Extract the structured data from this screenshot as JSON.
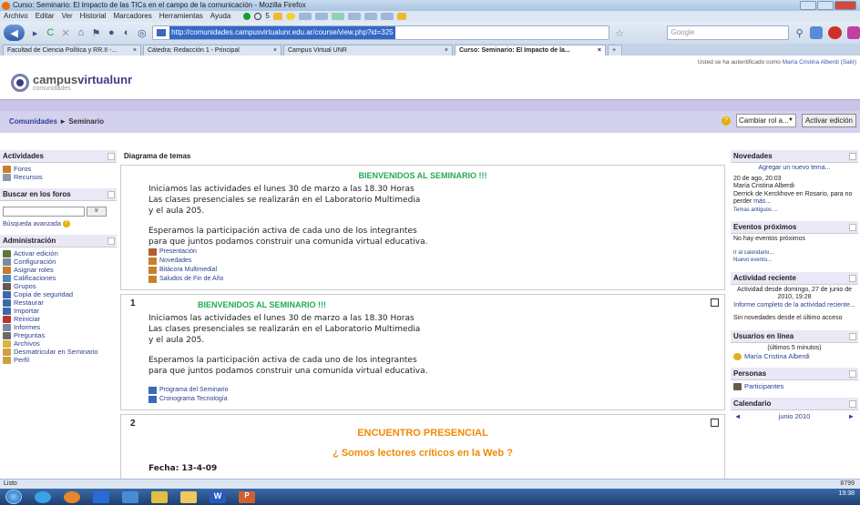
{
  "window": {
    "title": "Curso: Seminario: El Impacto de las TICs en el campo de la comunicación - Mozilla Firefox"
  },
  "menubar": [
    "Archivo",
    "Editar",
    "Ver",
    "Historial",
    "Marcadores",
    "Herramientas",
    "Ayuda"
  ],
  "toolbar_counter": "5",
  "navbar": {
    "url": "http://comunidades.campusvirtualunr.edu.ar/course/view.php?id=325",
    "search_placeholder": "Google"
  },
  "tabs": [
    {
      "label": "Facultad de Ciencia Política y RR.II -...",
      "active": false
    },
    {
      "label": "Cátedra: Redacción 1 - Principal",
      "active": false
    },
    {
      "label": "Campus Virtual UNR",
      "active": false
    },
    {
      "label": "Curso: Seminario: El Impacto de la...",
      "active": true
    }
  ],
  "site": {
    "logo_part1": "campus",
    "logo_part2": "virtualunr",
    "logo_sub": "comunidades",
    "login_prefix": "Usted se ha autentificado como",
    "login_user": "María Cristina Alberdi",
    "login_suffix": "(Salir)"
  },
  "breadcrumb": {
    "root": "Comunidades",
    "sep": "►",
    "current": "Seminario"
  },
  "role": {
    "label": "Cambiar rol a...",
    "button": "Activar edición"
  },
  "left": {
    "actividades": {
      "title": "Actividades",
      "items": [
        "Foros",
        "Recursos"
      ]
    },
    "buscar": {
      "title": "Buscar en los foros",
      "go": "Ir",
      "advanced": "Búsqueda avanzada"
    },
    "admin": {
      "title": "Administración",
      "items": [
        "Activar edición",
        "Configuración",
        "Asignar roles",
        "Calificaciones",
        "Grupos",
        "Copia de seguridad",
        "Restaurar",
        "Importar",
        "Reiniciar",
        "Informes",
        "Preguntas",
        "Archivos",
        "Desmatricular en Seminario",
        "Perfil"
      ]
    }
  },
  "center": {
    "title": "Diagrama de temas",
    "sec0": {
      "title": "BIENVENIDOS AL SEMINARIO !!!",
      "p1": "Iniciamos las actividades el lunes 30 de marzo a las 18.30 Horas",
      "p2": "Las clases presenciales se realizarán en el Laboratorio Multimedia",
      "p3": "y el aula 205.",
      "p4": "Esperamos la participación activa de cada uno de los integrantes",
      "p5": "para que juntos podamos construir una comunida virtual educativa.",
      "resources": [
        "Presentación",
        "Novedades",
        "Bitácora Multimedial",
        "Saludos de Fin de Año"
      ]
    },
    "sec1": {
      "num": "1",
      "title": "BIENVENIDOS AL SEMINARIO !!!",
      "p1": "Iniciamos las actividades el lunes 30 de marzo a las 18.30 Horas",
      "p2": "Las clases presenciales se realizarán en el Laboratorio Multimedia",
      "p3": "y el aula 205.",
      "p4": "Esperamos la participación activa de cada uno de los integrantes",
      "p5": "para que juntos podamos construir una comunida virtual educativa.",
      "resources": [
        "Programa del Seminario",
        "Cronograma Tecnología"
      ]
    },
    "sec2": {
      "num": "2",
      "title": "ENCUENTRO PRESENCIAL",
      "subtitle": "¿ Somos lectores críticos en la Web ?",
      "fecha": "Fecha: 13-4-09"
    }
  },
  "right": {
    "novedades": {
      "title": "Novedades",
      "add": "Agregar un nuevo tema...",
      "date": "20 de ago, 20:03",
      "author": "María Cristina Alberdi",
      "text": "Derrick de Kerckhove en Rosario, para no perder",
      "more": "más...",
      "old": "Temas antiguos ..."
    },
    "eventos": {
      "title": "Eventos próximos",
      "none": "No hay eventos próximos",
      "cal": "Ir al calendario...",
      "new": "Nuevo evento..."
    },
    "actividad": {
      "title": "Actividad reciente",
      "since": "Actividad desde domingo, 27 de junio de 2010, 19:28",
      "report": "Informe completo de la actividad reciente...",
      "none": "Sin novedades desde el último acceso"
    },
    "usuarios": {
      "title": "Usuarios en línea",
      "period": "(últimos 5 minutos)",
      "user": "María Cristina Alberdi"
    },
    "personas": {
      "title": "Personas",
      "item": "Participantes"
    },
    "calendario": {
      "title": "Calendario",
      "prev": "◄",
      "month": "junio 2010",
      "next": "►"
    }
  },
  "status": {
    "left": "Listo",
    "right": "8799"
  },
  "clock": {
    "time": "19:38"
  },
  "colors": {
    "accent_green": "#22aa55",
    "accent_orange": "#f08a00",
    "link": "#2a3f8f",
    "nav_lilac": "#d4d1ef"
  }
}
